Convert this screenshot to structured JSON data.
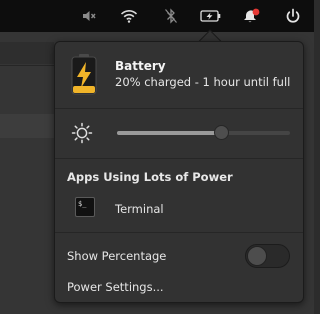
{
  "topbar": {
    "indicators": [
      {
        "icon": "volume-muted-icon",
        "active": false
      },
      {
        "icon": "wifi-icon",
        "active": false
      },
      {
        "icon": "bluetooth-disabled-icon",
        "active": false
      },
      {
        "icon": "battery-charging-icon",
        "active": true
      },
      {
        "icon": "notifications-icon",
        "active": false,
        "badge_color": "#e53935"
      },
      {
        "icon": "power-icon",
        "active": false
      }
    ]
  },
  "battery": {
    "title": "Battery",
    "status": "20% charged - 1 hour until full",
    "level_percent": 20,
    "bolt_color": "#f0b429",
    "icon": "battery-charging-large-icon"
  },
  "brightness": {
    "icon": "brightness-icon",
    "level": 0.6
  },
  "apps": {
    "heading": "Apps Using Lots of Power",
    "items": [
      {
        "name": "Terminal",
        "icon": "terminal-app-icon",
        "glyph": "$_"
      }
    ]
  },
  "show_percentage": {
    "label": "Show Percentage",
    "enabled": false
  },
  "power_settings": {
    "label": "Power Settings..."
  },
  "colors": {
    "panel": "#0d0d0d",
    "popover": "#323232",
    "accent_badge": "#e53935"
  }
}
